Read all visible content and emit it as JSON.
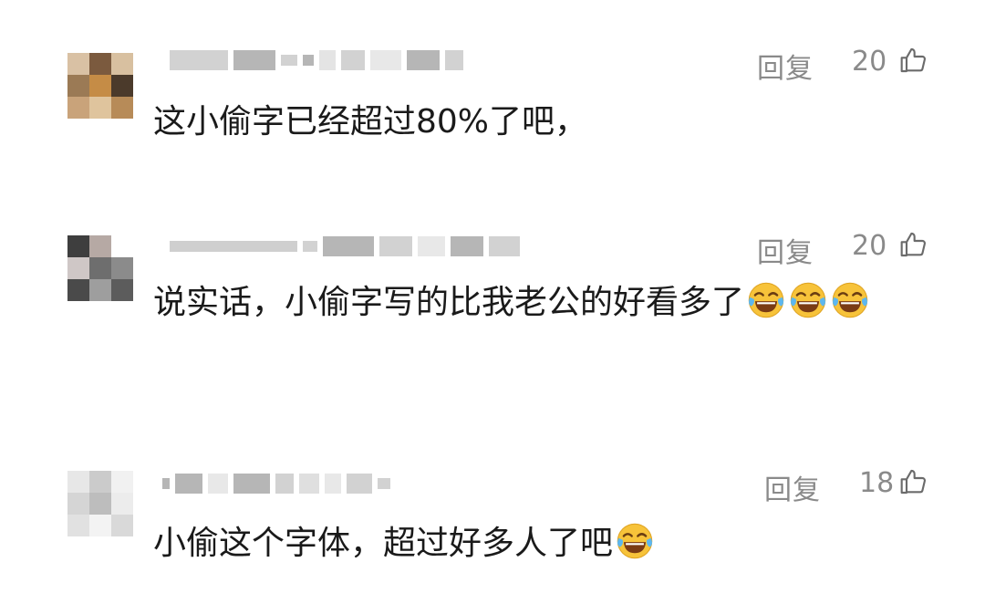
{
  "comments": [
    {
      "reply_label": "回复",
      "likes": "20",
      "text": "这小偷字已经超过80%了吧，",
      "emoji_count": 0,
      "avatar_colors": [
        "#d9c1a4",
        "#7b5a3e",
        "#d8c0a0",
        "#9b7a55",
        "#c58c46",
        "#4b3a2b",
        "#c9a37a",
        "#dfc49d",
        "#b78b58"
      ]
    },
    {
      "reply_label": "回复",
      "likes": "20",
      "text": "说实话，小偷字写的比我老公的好看多了",
      "emoji_count": 3,
      "avatar_colors": [
        "#3e3e3e",
        "#b6a9a4",
        "#ffffff",
        "#cfc7c6",
        "#6e6e6e",
        "#8b8b8b",
        "#4a4a4a",
        "#9e9e9e",
        "#5c5c5c"
      ]
    },
    {
      "reply_label": "回复",
      "likes": "18",
      "text": "小偷这个字体，超过好多人了吧",
      "emoji_count": 1,
      "avatar_colors": [
        "#e7e7e7",
        "#cbcbcb",
        "#f1f1f1",
        "#d5d5d5",
        "#bdbdbd",
        "#ececec",
        "#e1e1e1",
        "#f3f3f3",
        "#d9d9d9"
      ]
    }
  ],
  "icons": {
    "like": "thumbs-up-icon",
    "emoji": "tears-of-joy-emoji"
  }
}
